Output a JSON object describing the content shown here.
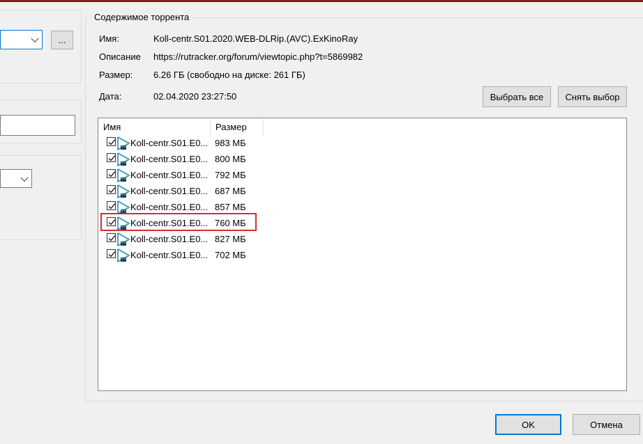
{
  "group_title": "Содержимое торрента",
  "info": {
    "name_label": "Имя:",
    "name_value": "Koll-centr.S01.2020.WEB-DLRip.(AVC).ExKinoRay",
    "description_label": "Описание",
    "description_value": "https://rutracker.org/forum/viewtopic.php?t=5869982",
    "size_label": "Размер:",
    "size_value": "6.26 ГБ (свободно на диске: 261 ГБ)",
    "date_label": "Дата:",
    "date_value": "02.04.2020 23:27:50"
  },
  "buttons": {
    "select_all": "Выбрать все",
    "deselect": "Снять выбор",
    "browse": "...",
    "ok": "OK",
    "cancel": "Отмена"
  },
  "file_list": {
    "columns": [
      "Имя",
      "Размер"
    ],
    "rows": [
      {
        "name": "Koll-centr.S01.E0...",
        "size": "983 МБ",
        "checked": true
      },
      {
        "name": "Koll-centr.S01.E0...",
        "size": "800 МБ",
        "checked": true
      },
      {
        "name": "Koll-centr.S01.E0...",
        "size": "792 МБ",
        "checked": true
      },
      {
        "name": "Koll-centr.S01.E0...",
        "size": "687 МБ",
        "checked": true
      },
      {
        "name": "Koll-centr.S01.E0...",
        "size": "857 МБ",
        "checked": true
      },
      {
        "name": "Koll-centr.S01.E0...",
        "size": "760 МБ",
        "checked": true
      },
      {
        "name": "Koll-centr.S01.E0...",
        "size": "827 МБ",
        "checked": true
      },
      {
        "name": "Koll-centr.S01.E0...",
        "size": "702 МБ",
        "checked": true
      }
    ],
    "row_icon": "video-file-icon",
    "highlighted_row": 5
  },
  "colors": {
    "title_accent": "#8b1a1a",
    "highlight": "#d0312d",
    "focus": "#0078d7"
  }
}
